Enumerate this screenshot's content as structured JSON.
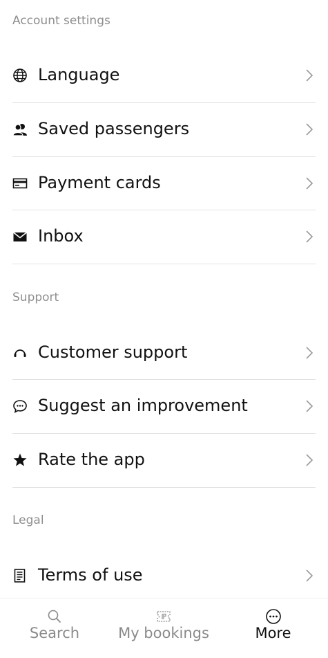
{
  "sections": [
    {
      "header": "Account settings",
      "items": [
        {
          "label": "Language",
          "icon": "globe-icon"
        },
        {
          "label": "Saved passengers",
          "icon": "passengers-icon"
        },
        {
          "label": "Payment cards",
          "icon": "credit-card-icon"
        },
        {
          "label": "Inbox",
          "icon": "envelope-icon"
        }
      ]
    },
    {
      "header": "Support",
      "items": [
        {
          "label": "Customer support",
          "icon": "headset-icon"
        },
        {
          "label": "Suggest an improvement",
          "icon": "chat-bubble-icon"
        },
        {
          "label": "Rate the app",
          "icon": "star-icon"
        }
      ]
    },
    {
      "header": "Legal",
      "items": [
        {
          "label": "Terms of use",
          "icon": "document-icon"
        }
      ]
    }
  ],
  "bottom_nav": {
    "items": [
      {
        "label": "Search",
        "icon": "search-icon",
        "active": false
      },
      {
        "label": "My bookings",
        "icon": "ticket-icon",
        "active": false
      },
      {
        "label": "More",
        "icon": "more-dots-icon",
        "active": true
      }
    ]
  },
  "colors": {
    "text": "#111111",
    "muted": "#8e8e8e",
    "divider": "#e2e2e2",
    "chevron": "#9a9a9a"
  }
}
